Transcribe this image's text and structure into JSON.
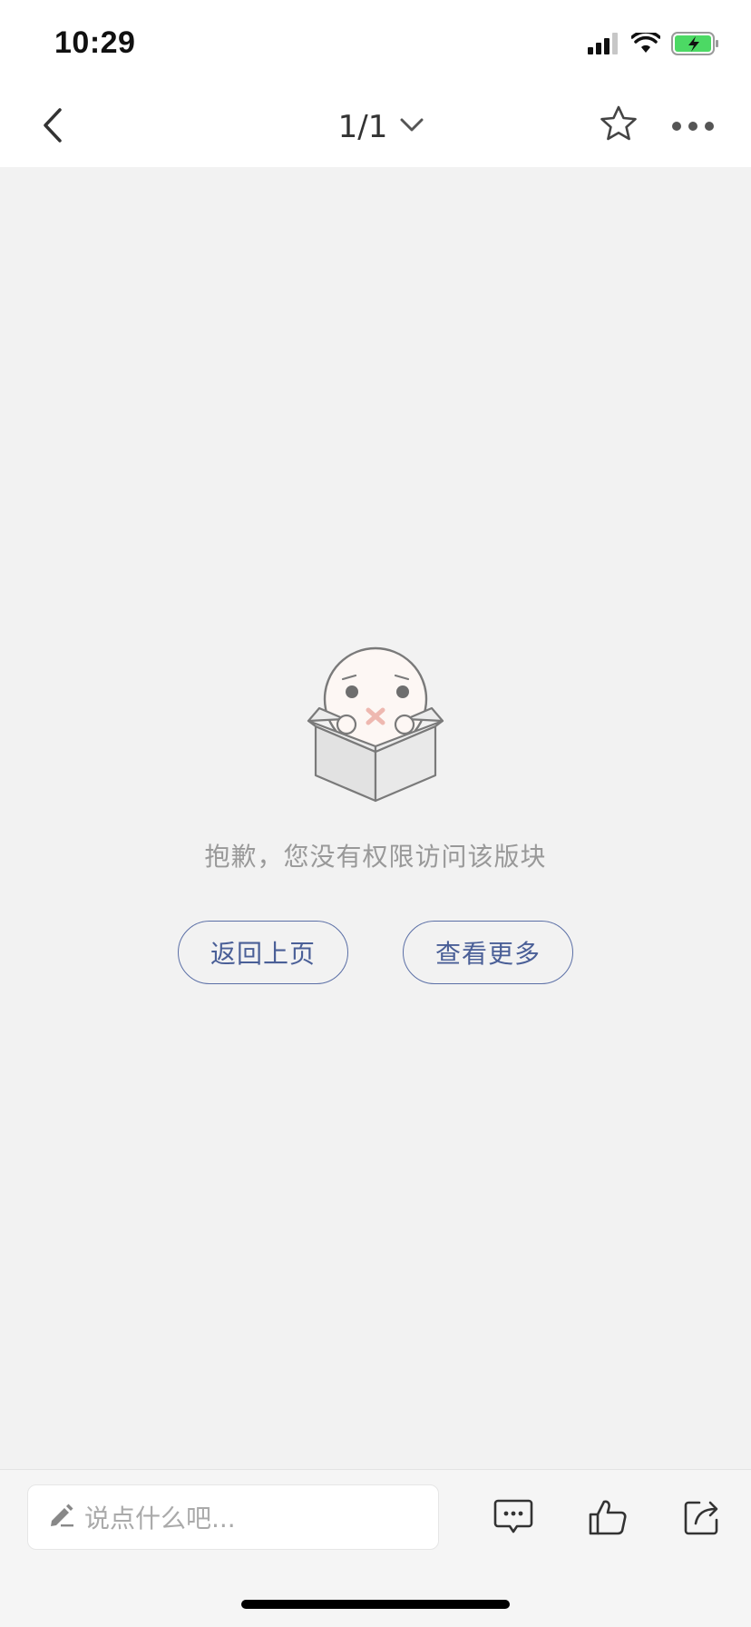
{
  "status_bar": {
    "time": "10:29",
    "icons": [
      "signal-icon",
      "wifi-icon",
      "battery-charging-icon"
    ],
    "battery_color": "#4cd964"
  },
  "nav": {
    "back_icon": "chevron-left-icon",
    "page_indicator": "1/1",
    "dropdown_icon": "chevron-down-icon",
    "favorite_icon": "star-outline-icon",
    "more_icon": "more-dots-icon"
  },
  "empty_state": {
    "illustration": "sad-face-in-box-illustration",
    "message": "抱歉，您没有权限访问该版块",
    "back_button": "返回上页",
    "more_button": "查看更多",
    "button_color": "#5b6fa6"
  },
  "bottom_bar": {
    "comment_placeholder": "说点什么吧...",
    "icons": [
      "pencil-icon",
      "comment-icon",
      "thumbs-up-icon",
      "share-icon"
    ]
  },
  "colors": {
    "background": "#f2f2f2",
    "accent": "#5b6fa6",
    "muted_text": "#999999"
  }
}
